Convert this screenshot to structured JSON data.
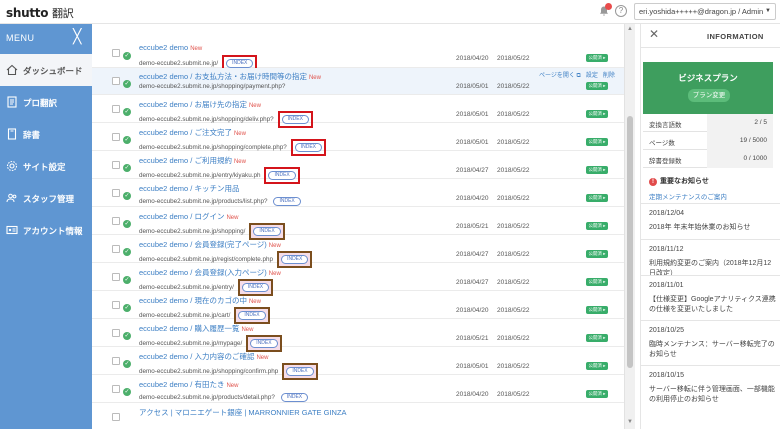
{
  "app": {
    "logo_main": "shutto",
    "logo_sub": "翻訳"
  },
  "header": {
    "account": "eri.yoshida+++++@dragon.jp / Admin"
  },
  "sidebar": {
    "menu_label": "MENU",
    "items": [
      {
        "label": "ダッシュボード",
        "icon": "home-icon"
      },
      {
        "label": "プロ翻訳",
        "icon": "document-icon"
      },
      {
        "label": "辞書",
        "icon": "book-icon"
      },
      {
        "label": "サイト設定",
        "icon": "gear-icon"
      },
      {
        "label": "スタッフ管理",
        "icon": "users-icon"
      },
      {
        "label": "アカウント情報",
        "icon": "id-card-icon"
      }
    ]
  },
  "pages": [
    {
      "title": "eccube2 demo",
      "new": "New",
      "url": "demo-eccube2.submit.ne.jp/",
      "index": "INDEX",
      "frame": "red",
      "pink": false,
      "date1": "2018/04/20",
      "date2": "2018/05/22",
      "status": "公開済 ▸"
    },
    {
      "title": "eccube2 demo / お支払方法・お届け時間等の指定",
      "new": "New",
      "url": "demo-eccube2.submit.ne.jp/shopping/payment.php?",
      "index": "",
      "frame": "",
      "pink": false,
      "date1": "2018/05/01",
      "date2": "2018/05/22",
      "status": "公開済 ▸",
      "actions": [
        "ページを開く ⧉",
        "設定",
        "削除"
      ]
    },
    {
      "title": "eccube2 demo / お届け先の指定",
      "new": "New",
      "url": "demo-eccube2.submit.ne.jp/shopping/deliv.php?",
      "index": "INDEX",
      "frame": "red",
      "pink": false,
      "date1": "2018/05/01",
      "date2": "2018/05/22",
      "status": "公開済 ▸"
    },
    {
      "title": "eccube2 demo / ご注文完了",
      "new": "New",
      "url": "demo-eccube2.submit.ne.jp/shopping/complete.php?",
      "index": "INDEX",
      "frame": "red",
      "pink": false,
      "date1": "2018/05/01",
      "date2": "2018/05/22",
      "status": "公開済 ▸"
    },
    {
      "title": "eccube2 demo / ご利用規約",
      "new": "New",
      "url": "demo-eccube2.submit.ne.jp/entry/kiyaku.ph",
      "index": "INDEX",
      "frame": "red",
      "pink": false,
      "date1": "2018/04/27",
      "date2": "2018/05/22",
      "status": "公開済 ▸"
    },
    {
      "title": "eccube2 demo / キッチン用品",
      "new": "",
      "url": "demo-eccube2.submit.ne.jp/products/list.php?",
      "index": "INDEX",
      "frame": "",
      "pink": false,
      "date1": "2018/04/20",
      "date2": "2018/05/22",
      "status": "公開済 ▸"
    },
    {
      "title": "eccube2 demo / ログイン",
      "new": "New",
      "url": "demo-eccube2.submit.ne.jp/shopping/",
      "index": "INDEX",
      "frame": "brown",
      "pink": true,
      "date1": "2018/05/21",
      "date2": "2018/05/22",
      "status": "公開済 ▸"
    },
    {
      "title": "eccube2 demo / 会員登録(完了ページ)",
      "new": "New",
      "url": "demo-eccube2.submit.ne.jp/regist/complete.php",
      "index": "INDEX",
      "frame": "brown",
      "pink": true,
      "date1": "2018/04/27",
      "date2": "2018/05/22",
      "status": "公開済 ▸"
    },
    {
      "title": "eccube2 demo / 会員登録(入力ページ)",
      "new": "New",
      "url": "demo-eccube2.submit.ne.jp/entry/",
      "index": "INDEX",
      "frame": "brown",
      "pink": true,
      "date1": "2018/04/27",
      "date2": "2018/05/22",
      "status": "公開済 ▸"
    },
    {
      "title": "eccube2 demo / 現在のカゴの中",
      "new": "New",
      "url": "demo-eccube2.submit.ne.jp/cart/",
      "index": "INDEX",
      "frame": "brown",
      "pink": true,
      "date1": "2018/04/20",
      "date2": "2018/05/22",
      "status": "公開済 ▸"
    },
    {
      "title": "eccube2 demo / 購入履歴一覧",
      "new": "New",
      "url": "demo-eccube2.submit.ne.jp/mypage/",
      "index": "INDEX",
      "frame": "brown",
      "pink": true,
      "date1": "2018/05/21",
      "date2": "2018/05/22",
      "status": "公開済 ▸"
    },
    {
      "title": "eccube2 demo / 入力内容のご確認",
      "new": "New",
      "url": "demo-eccube2.submit.ne.jp/shopping/confirm.php",
      "index": "INDEX",
      "frame": "brown",
      "pink": true,
      "date1": "2018/05/01",
      "date2": "2018/05/22",
      "status": "公開済 ▸"
    },
    {
      "title": "eccube2 demo / 有田たき",
      "new": "New",
      "url": "demo-eccube2.submit.ne.jp/products/detail.php?",
      "index": "INDEX",
      "frame": "",
      "pink": false,
      "date1": "2018/04/20",
      "date2": "2018/05/22",
      "status": "公開済 ▸"
    },
    {
      "title": "アクセス | マロニエゲート銀座 | MARRONNIER GATE GINZA",
      "new": "",
      "url": "",
      "index": "",
      "frame": "",
      "pink": false,
      "date1": "",
      "date2": "",
      "status": ""
    }
  ],
  "info": {
    "title": "INFORMATION",
    "plan_name": "ビジネスプラン",
    "plan_button": "プラン変更",
    "stats": [
      {
        "label": "変換言語数",
        "value": "2 / 5"
      },
      {
        "label": "ページ数",
        "value": "19 / 5000"
      },
      {
        "label": "辞書登録数",
        "value": "0 / 1000"
      }
    ],
    "notice_heading": "重要なお知らせ",
    "notice_link": "定期メンテナンスのご案内",
    "news": [
      {
        "date": "2018/12/04",
        "text": "2018年 年末年始休業のお知らせ"
      },
      {
        "date": "2018/11/12",
        "text": "利用規約変更のご案内（2018年12月12日改定）"
      },
      {
        "date": "2018/11/01",
        "text": "【仕様変更】Googleアナリティクス連携の仕様を変更いたしました"
      },
      {
        "date": "2018/10/25",
        "text": "臨時メンテナンス：サーバー移転完了のお知らせ"
      },
      {
        "date": "2018/10/15",
        "text": "サーバー移転に伴う管理画面、一部機能の利用停止のお知らせ"
      }
    ]
  }
}
